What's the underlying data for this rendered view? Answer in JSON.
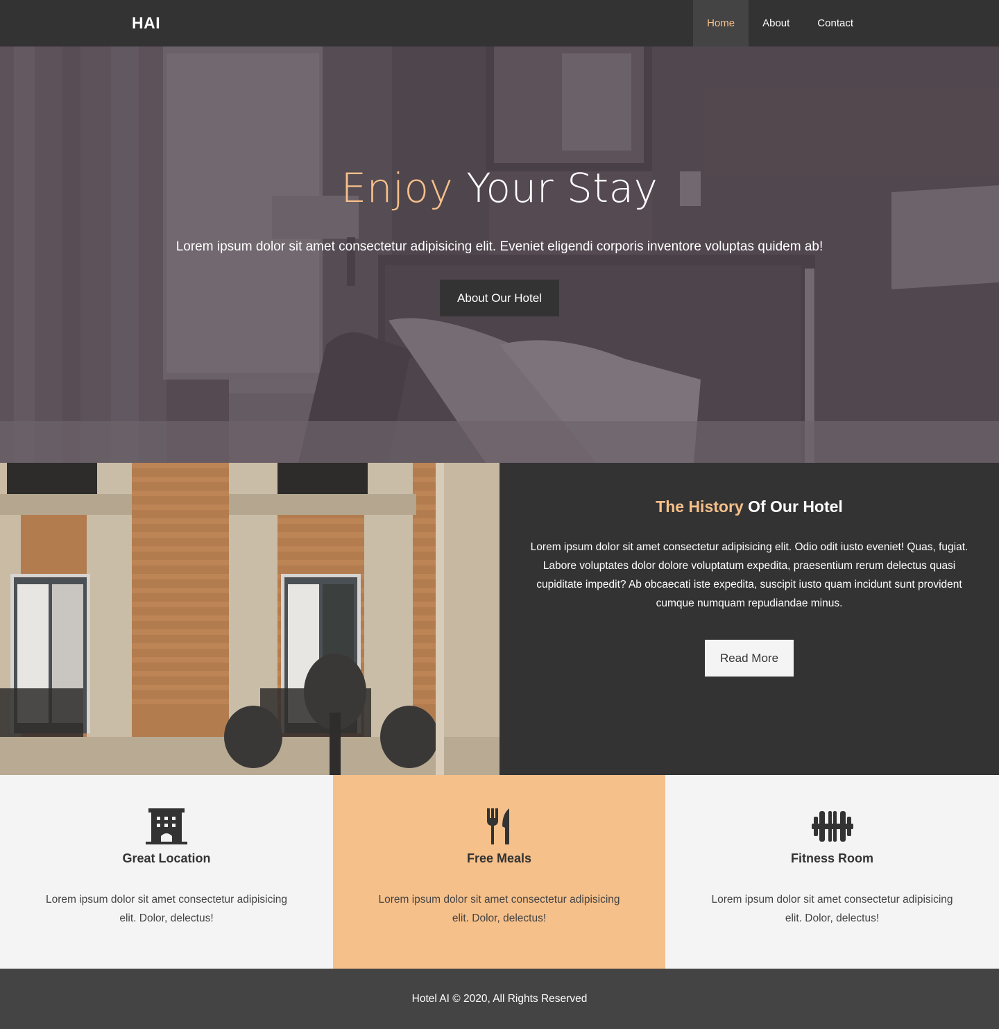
{
  "nav": {
    "logo": "HAI",
    "links": [
      "Home",
      "About",
      "Contact"
    ],
    "active": "Home"
  },
  "hero": {
    "title_accent": "Enjoy",
    "title_rest": " Your Stay",
    "text": "Lorem ipsum dolor sit amet consectetur adipisicing elit. Eveniet eligendi corporis inventore voluptas quidem ab!",
    "button": "About Our Hotel"
  },
  "history": {
    "title_accent": "The History",
    "title_rest": " Of Our Hotel",
    "text": "Lorem ipsum dolor sit amet consectetur adipisicing elit. Odio odit iusto eveniet! Quas, fugiat. Labore voluptates dolor dolore voluptatum expedita, praesentium rerum delectus quasi cupiditate impedit? Ab obcaecati iste expedita, suscipit iusto quam incidunt sunt provident cumque numquam repudiandae minus.",
    "button": "Read More"
  },
  "features": [
    {
      "icon": "hotel-building-icon",
      "title": "Great Location",
      "text": "Lorem ipsum dolor sit amet consectetur adipisicing elit. Dolor, delectus!"
    },
    {
      "icon": "utensils-icon",
      "title": "Free Meals",
      "text": "Lorem ipsum dolor sit amet consectetur adipisicing elit. Dolor, delectus!"
    },
    {
      "icon": "dumbbell-icon",
      "title": "Fitness Room",
      "text": "Lorem ipsum dolor sit amet consectetur adipisicing elit. Dolor, delectus!"
    }
  ],
  "footer": {
    "text": "Hotel AI © 2020, All Rights Reserved"
  },
  "colors": {
    "accent": "#f7c08a",
    "dark": "#333333",
    "light": "#f4f4f4",
    "feature_highlight": "#f6c08a"
  }
}
